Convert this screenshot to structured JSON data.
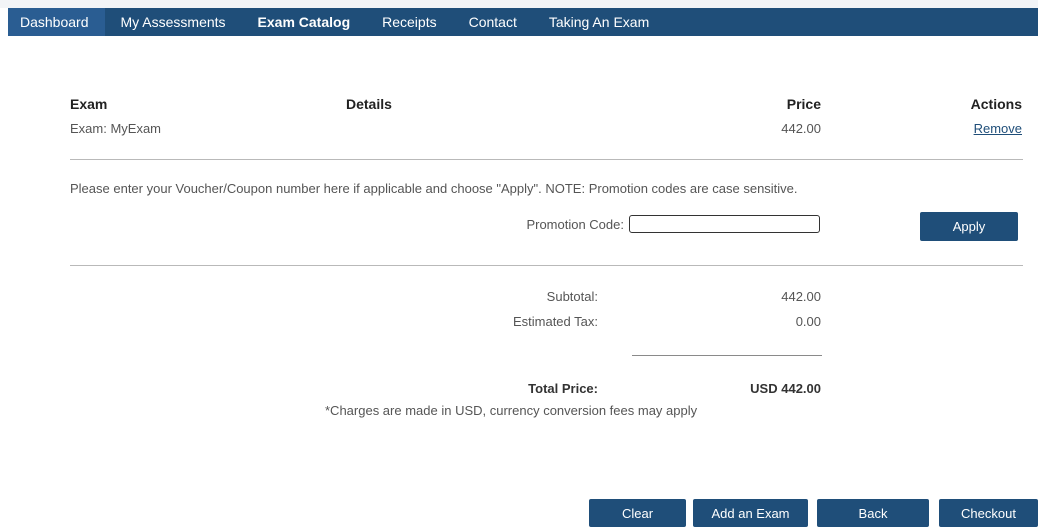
{
  "nav": {
    "items": [
      {
        "label": "Dashboard"
      },
      {
        "label": "My Assessments"
      },
      {
        "label": "Exam Catalog"
      },
      {
        "label": "Receipts"
      },
      {
        "label": "Contact"
      },
      {
        "label": "Taking An Exam"
      }
    ],
    "active": "Dashboard",
    "current": "Exam Catalog"
  },
  "cart": {
    "headers": {
      "exam": "Exam",
      "details": "Details",
      "price": "Price",
      "actions": "Actions"
    },
    "rows": [
      {
        "exam": "Exam: MyExam",
        "details": "",
        "price": "442.00",
        "action": "Remove"
      }
    ]
  },
  "promo": {
    "instructions": "Please enter your Voucher/Coupon number here if applicable and choose \"Apply\". NOTE: Promotion codes are case sensitive.",
    "label": "Promotion Code:",
    "value": "",
    "apply_label": "Apply"
  },
  "totals": {
    "subtotal_label": "Subtotal:",
    "subtotal_value": "442.00",
    "tax_label": "Estimated Tax:",
    "tax_value": "0.00",
    "total_label": "Total Price:",
    "total_value": "USD 442.00",
    "note": "*Charges are made in USD, currency conversion fees may apply"
  },
  "actions": {
    "clear": "Clear",
    "add": "Add an Exam",
    "back": "Back",
    "checkout": "Checkout"
  },
  "colors": {
    "nav_bg": "#1f4e79",
    "nav_active": "#2a5d92",
    "button_bg": "#1f4e79"
  }
}
